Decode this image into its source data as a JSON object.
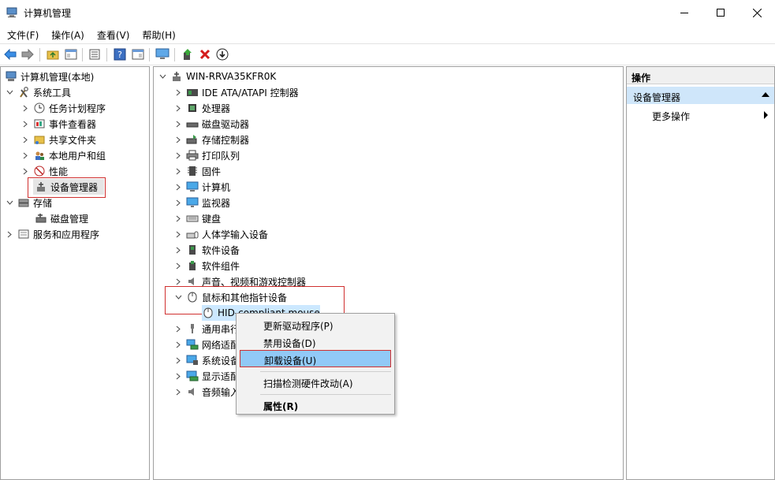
{
  "window": {
    "title": "计算机管理"
  },
  "menu": [
    "文件(F)",
    "操作(A)",
    "查看(V)",
    "帮助(H)"
  ],
  "colors": {
    "accent": "#0078d7",
    "highlight_red": "#d0302f",
    "selection": "#91c9f7",
    "section_blue": "#cfe6fa"
  },
  "left_tree": {
    "root": "计算机管理(本地)",
    "system_tools": "系统工具",
    "task_scheduler": "任务计划程序",
    "event_viewer": "事件查看器",
    "shared_folders": "共享文件夹",
    "local_users": "本地用户和组",
    "performance": "性能",
    "device_manager": "设备管理器",
    "storage": "存储",
    "disk_management": "磁盘管理",
    "services_apps": "服务和应用程序"
  },
  "device_tree": {
    "computer": "WIN-RRVA35KFR0K",
    "categories": [
      {
        "label": "IDE ATA/ATAPI 控制器",
        "icon": "ide-controller-icon"
      },
      {
        "label": "处理器",
        "icon": "processor-icon"
      },
      {
        "label": "磁盘驱动器",
        "icon": "disk-drive-icon"
      },
      {
        "label": "存储控制器",
        "icon": "storage-controller-icon"
      },
      {
        "label": "打印队列",
        "icon": "printer-icon"
      },
      {
        "label": "固件",
        "icon": "firmware-icon"
      },
      {
        "label": "计算机",
        "icon": "computer-icon"
      },
      {
        "label": "监视器",
        "icon": "monitor-icon"
      },
      {
        "label": "键盘",
        "icon": "keyboard-icon"
      },
      {
        "label": "人体学输入设备",
        "icon": "hid-icon"
      },
      {
        "label": "软件设备",
        "icon": "software-device-icon"
      },
      {
        "label": "软件组件",
        "icon": "software-component-icon"
      },
      {
        "label": "声音、视频和游戏控制器",
        "icon": "sound-icon"
      },
      {
        "label": "鼠标和其他指针设备",
        "icon": "mouse-icon"
      }
    ],
    "mouse_child": "HID-compliant mouse",
    "after": [
      {
        "label": "通用串行",
        "icon": "usb-icon"
      },
      {
        "label": "网络适配",
        "icon": "network-icon"
      },
      {
        "label": "系统设备",
        "icon": "system-device-icon"
      },
      {
        "label": "显示适配",
        "icon": "display-adapter-icon"
      },
      {
        "label": "音频输入",
        "icon": "audio-icon"
      }
    ]
  },
  "context_menu": {
    "update_driver": "更新驱动程序(P)",
    "disable": "禁用设备(D)",
    "uninstall": "卸载设备(U)",
    "scan": "扫描检测硬件改动(A)",
    "properties": "属性(R)"
  },
  "actions_pane": {
    "header": "操作",
    "section": "设备管理器",
    "more": "更多操作"
  }
}
